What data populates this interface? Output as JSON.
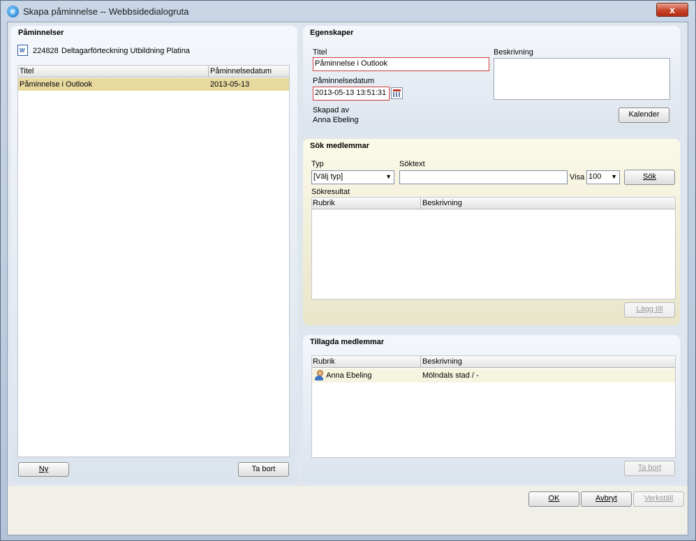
{
  "window": {
    "title": "Skapa påminnelse -- Webbsidedialogruta",
    "close_glyph": "x"
  },
  "left_panel": {
    "title": "Påminnelser",
    "reference": {
      "icon": "word-document-icon",
      "id": "224828",
      "name": "Deltagarförteckning Utbildning Platina"
    },
    "columns": [
      "Titel",
      "Påminnelsedatum"
    ],
    "rows": [
      {
        "title": "Påminnelse i Outlook",
        "date": "2013-05-13"
      }
    ],
    "new_button": "Ny",
    "delete_button": "Ta bort"
  },
  "properties": {
    "title": "Egenskaper",
    "titel_label": "Titel",
    "titel_value": "Påminnelse i Outlook",
    "date_label": "Påminnelsedatum",
    "date_value": "2013-05-13 13:51:31",
    "description_label": "Beskrivning",
    "description_value": "",
    "created_by_label": "Skapad av",
    "created_by_value": "Anna Ebeling",
    "calendar_button": "Kalender"
  },
  "search": {
    "title": "Sök medlemmar",
    "type_label": "Typ",
    "type_value": "[Välj typ]",
    "text_label": "Söktext",
    "text_value": "",
    "show_label": "Visa",
    "show_value": "100",
    "search_button": "Sök",
    "results_label": "Sökresultat",
    "columns": [
      "Rubrik",
      "Beskrivning"
    ],
    "add_button": "Lägg till"
  },
  "added": {
    "title": "Tillagda medlemmar",
    "columns": [
      "Rubrik",
      "Beskrivning"
    ],
    "rows": [
      {
        "icon": "user-icon",
        "name": "Anna Ebeling",
        "description": "Mölndals stad / -"
      }
    ],
    "delete_button": "Ta bort"
  },
  "footer": {
    "ok": "OK",
    "cancel": "Avbryt",
    "apply": "Verkställ"
  },
  "colors": {
    "required_border": "#d03a3a",
    "selected_row": "#e8d9a0",
    "close_button": "#c7452c"
  }
}
